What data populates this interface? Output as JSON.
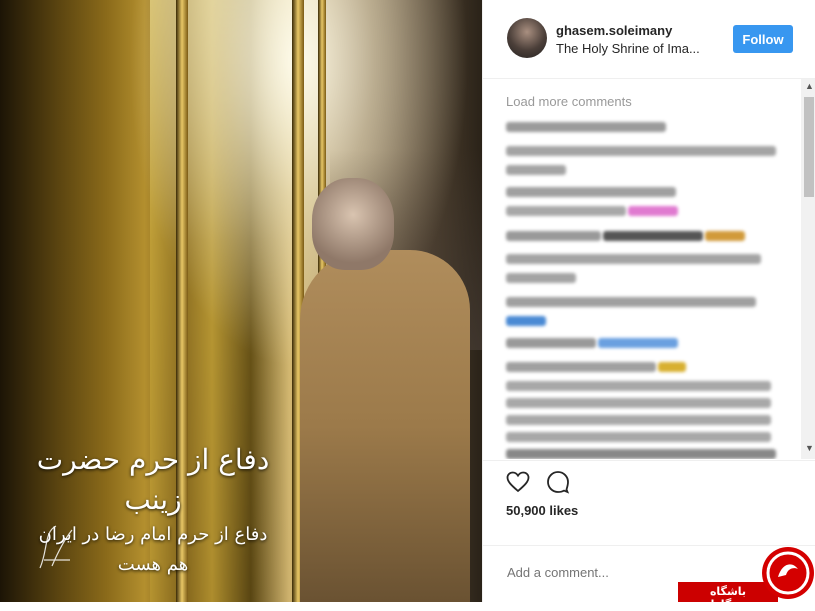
{
  "post": {
    "image": {
      "calligraphy_line1": "دفاع از حرم حضرت زینب",
      "calligraphy_line2": "دفاع از حرم امام رضا در ایران هم هست"
    }
  },
  "header": {
    "username": "ghasem.soleimany",
    "location": "The Holy Shrine of Ima...",
    "follow_label": "Follow"
  },
  "comments": {
    "load_more_label": "Load more comments"
  },
  "actions": {
    "likes_text": "50,900 likes"
  },
  "add_comment": {
    "placeholder": "Add a comment..."
  },
  "watermark": {
    "text": "باشگاه خبرنگاران"
  },
  "colors": {
    "follow_button": "#3897f0",
    "watermark_red": "#cc0000"
  }
}
